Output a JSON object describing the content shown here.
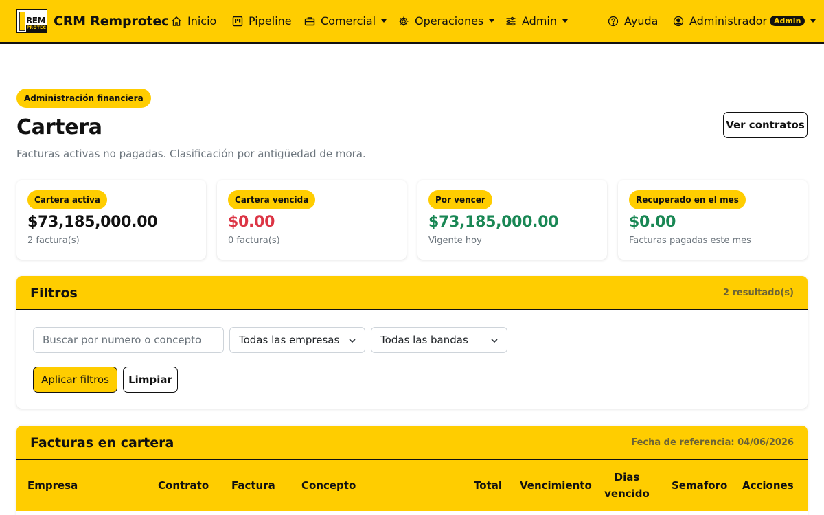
{
  "navbar": {
    "logo_text_top": "REM",
    "logo_text_bottom": "PROTEC",
    "brand": "CRM Remprotec",
    "items": {
      "inicio": "Inicio",
      "pipeline": "Pipeline",
      "comercial": "Comercial",
      "operaciones": "Operaciones",
      "admin": "Admin"
    },
    "help": "Ayuda",
    "user": "Administrador",
    "user_badge": "Admin"
  },
  "header": {
    "section": "Administración financiera",
    "title": "Cartera",
    "subtitle": "Facturas activas no pagadas. Clasificación por antigüedad de mora.",
    "contracts_button": "Ver contratos"
  },
  "stats": [
    {
      "label": "Cartera activa",
      "amount": "$73,185,000.00",
      "note": "2 factura(s)",
      "color": "#111111"
    },
    {
      "label": "Cartera vencida",
      "amount": "$0.00",
      "note": "0 factura(s)",
      "color": "#dc3545"
    },
    {
      "label": "Por vencer",
      "amount": "$73,185,000.00",
      "note": "Vigente hoy",
      "color": "#198754"
    },
    {
      "label": "Recuperado en el mes",
      "amount": "$0.00",
      "note": "Facturas pagadas este mes",
      "color": "#198754"
    }
  ],
  "filters": {
    "title": "Filtros",
    "result_count": "2 resultado(s)",
    "search_placeholder": "Buscar por numero o concepto",
    "company_select": "Todas las empresas",
    "band_select": "Todas las bandas",
    "apply_button": "Aplicar filtros",
    "clear_button": "Limpiar"
  },
  "invoices": {
    "title": "Facturas en cartera",
    "reference_date": "Fecha de referencia: 04/06/2026",
    "columns": {
      "empresa": "Empresa",
      "contrato": "Contrato",
      "factura": "Factura",
      "concepto": "Concepto",
      "total": "Total",
      "vencimiento": "Vencimiento",
      "dias_1": "Dias",
      "dias_2": "vencido",
      "semaforo": "Semaforo",
      "acciones": "Acciones"
    }
  },
  "colors": {
    "brand": "#ffcd00",
    "danger": "#dc3545",
    "success": "#198754",
    "muted": "#6c757d"
  }
}
